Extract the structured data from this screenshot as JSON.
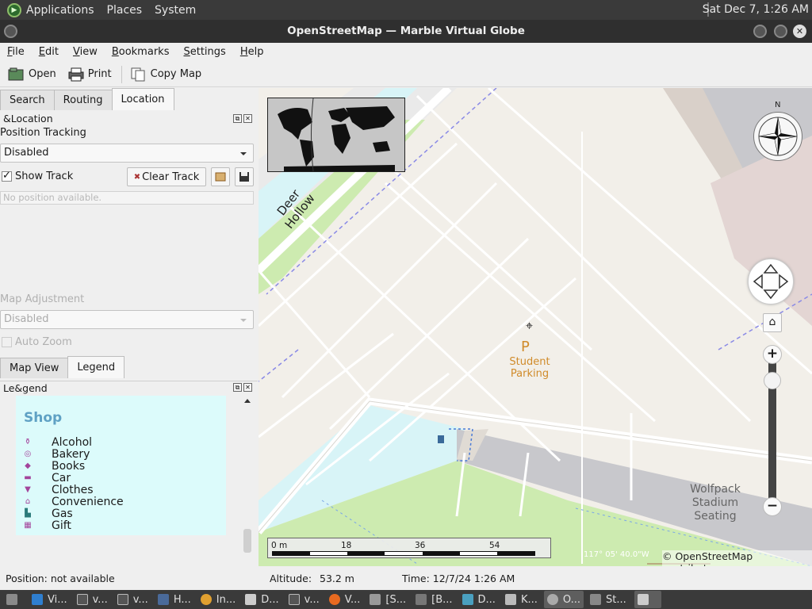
{
  "top_panel": {
    "menus": [
      "Applications",
      "Places",
      "System"
    ],
    "clock": "Sat Dec  7,  1:26 AM"
  },
  "window": {
    "title": "OpenStreetMap — Marble Virtual Globe"
  },
  "menubar": [
    "File",
    "Edit",
    "View",
    "Bookmarks",
    "Settings",
    "Help"
  ],
  "toolbar": {
    "open": "Open",
    "print": "Print",
    "copy_map": "Copy Map"
  },
  "top_tabs": [
    "Search",
    "Routing",
    "Location"
  ],
  "location_panel": {
    "title": "&Location",
    "position_tracking_label": "Position Tracking",
    "position_tracking_value": "Disabled",
    "show_track_label": "Show Track",
    "show_track_checked": true,
    "clear_track_label": "Clear Track",
    "position_info": "No position available.",
    "map_adjustment_label": "Map Adjustment",
    "map_adjustment_value": "Disabled",
    "auto_zoom_label": "Auto Zoom"
  },
  "bottom_tabs": [
    "Map View",
    "Legend"
  ],
  "legend_panel": {
    "title": "Le&gend",
    "section": "Shop",
    "items": [
      "Alcohol",
      "Bakery",
      "Books",
      "Car",
      "Clothes",
      "Convenience",
      "Gas",
      "Gift"
    ]
  },
  "map": {
    "street_label": "Deer Hollow",
    "parking_symbol": "P",
    "parking_label_line1": "Student",
    "parking_label_line2": "Parking",
    "stadium_line1": "Wolfpack",
    "stadium_line2": "Stadium",
    "stadium_line3": "Seating",
    "compass_n": "N",
    "scale_labels": [
      "0 m",
      "18",
      "36",
      "54"
    ],
    "coords": "117° 05' 40.0\"W",
    "copyright": "© OpenStreetMap contributors",
    "colors": {
      "parking_orange": "#d08b2a",
      "grass": "#cdebb0",
      "water": "#d8f4f7"
    }
  },
  "statusbar": {
    "position": "Position: not available",
    "altitude_label": "Altitude:",
    "altitude_value": "53.2 m",
    "time": "Time: 12/7/24 1:26 AM"
  },
  "taskbar": {
    "items": [
      "Vi...",
      "v...",
      "v...",
      "H...",
      "In...",
      "D...",
      "v...",
      "V...",
      "[S...",
      "[B...",
      "D...",
      "K...",
      "O...",
      "St..."
    ]
  }
}
